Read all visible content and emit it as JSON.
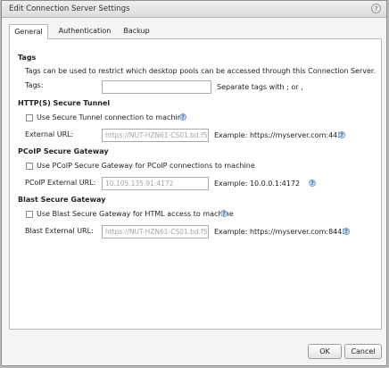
{
  "window": {
    "title": "Edit Connection Server Settings"
  },
  "tabs": [
    {
      "label": "General"
    },
    {
      "label": "Authentication"
    },
    {
      "label": "Backup"
    }
  ],
  "tags": {
    "heading": "Tags",
    "description": "Tags can be used to restrict which desktop pools can be accessed through this Connection Server.",
    "field_label": "Tags:",
    "value": "",
    "hint": "Separate tags with ; or ,"
  },
  "secure_tunnel": {
    "heading": "HTTP(S) Secure Tunnel",
    "checkbox_label": "Use Secure Tunnel connection to machine",
    "checked": false,
    "field_label": "External URL:",
    "value": "https://NUT-HZN61-CS01.bd.f5",
    "example": "Example: https://myserver.com:443"
  },
  "pcoip": {
    "heading": "PCoIP Secure Gateway",
    "checkbox_label": "Use PCoIP Secure Gateway for PCoIP connections to machine",
    "checked": false,
    "field_label": "PCoIP External URL:",
    "value": "10.105.135.91:4172",
    "example": "Example: 10.0.0.1:4172"
  },
  "blast": {
    "heading": "Blast Secure Gateway",
    "checkbox_label": "Use Blast Secure Gateway for HTML access to machine",
    "checked": false,
    "field_label": "Blast External URL:",
    "value": "https://NUT-HZN61-CS01.bd.f5",
    "example": "Example: https://myserver.com:8443"
  },
  "buttons": {
    "ok": "OK",
    "cancel": "Cancel"
  },
  "icons": {
    "help": "?",
    "info": "?"
  }
}
